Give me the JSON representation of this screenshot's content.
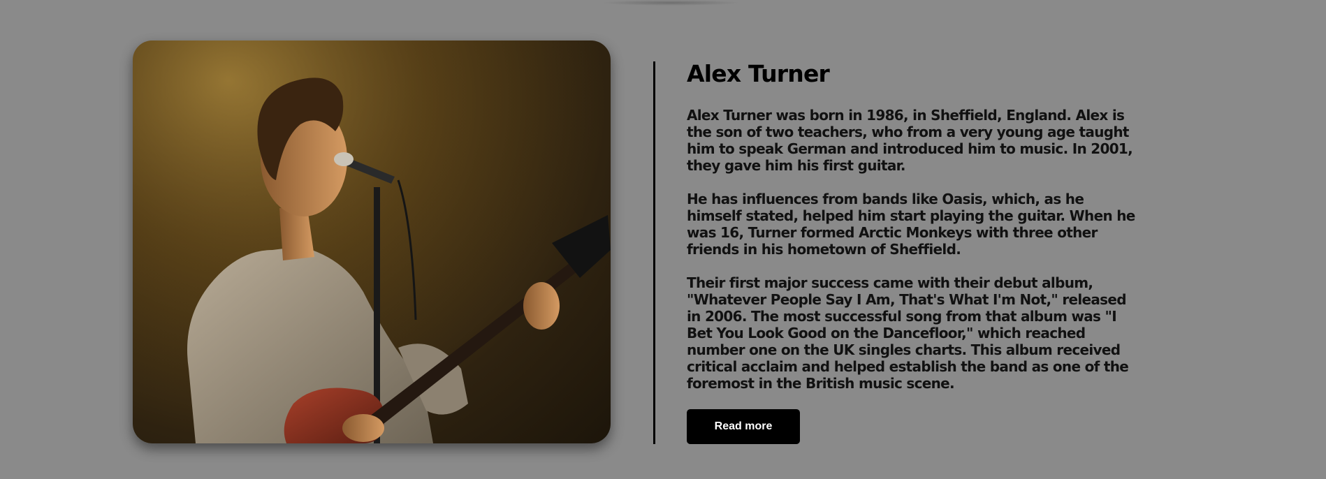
{
  "profile": {
    "name": "Alex Turner",
    "paragraphs": [
      "Alex Turner was born in 1986, in Sheffield, England. Alex is the son of two teachers, who from a very young age taught him to speak German and introduced him to music. In 2001, they gave him his first guitar.",
      "He has influences from bands like Oasis, which, as he himself stated, helped him start playing the guitar. When he was 16, Turner formed Arctic Monkeys with three other friends in his hometown of Sheffield.",
      "Their first major success came with their debut album, \"Whatever People Say I Am, That's What I'm Not,\" released in 2006. The most successful song from that album was \"I Bet You Look Good on the Dancefloor,\" which reached number one on the UK singles charts. This album received critical acclaim and helped establish the band as one of the foremost in the British music scene."
    ],
    "button_label": "Read more",
    "photo_icon": "guitarist-photo"
  },
  "colors": {
    "background": "#8a8a8a",
    "text": "#111111",
    "button_bg": "#000000",
    "button_text": "#ffffff"
  }
}
